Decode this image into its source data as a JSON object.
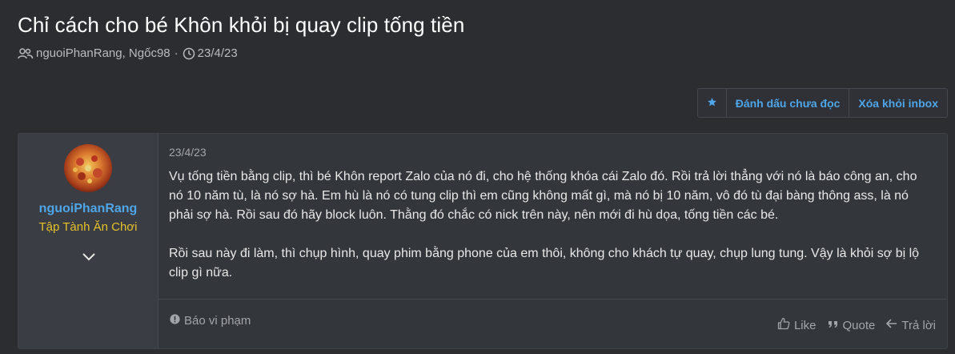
{
  "thread": {
    "title": "Chỉ cách cho bé Khôn khỏi bị quay clip tống tiền",
    "participants": "nguoiPhanRang, Ngốc98",
    "date": "23/4/23"
  },
  "actions": {
    "star_icon": "star-icon",
    "mark_unread": "Đánh dấu chưa đọc",
    "remove_inbox": "Xóa khỏi inbox"
  },
  "post": {
    "author": "nguoiPhanRang",
    "author_title": "Tập Tành Ăn Chơi",
    "date": "23/4/23",
    "paragraphs": [
      "Vụ tống tiền bằng clip, thì bé Khôn report Zalo của nó đi, cho hệ thống khóa cái Zalo đó. Rồi trả lời thẳng với nó là báo công an, cho nó 10 năm tù, là nó sợ hà. Em hù là nó có tung clip thì em cũng không mất gì, mà nó bị 10 năm, vô đó tù đại bàng thông ass, là nó phải sợ hà. Rồi sau đó hãy block luôn. Thằng đó chắc có nick trên này, nên mới đi hù dọa, tống tiền các bé.",
      "Rồi sau này đi làm, thì chụp hình, quay phim bằng phone của em thôi, không cho khách tự quay, chụp lung tung. Vậy là khỏi sợ bị lộ clip gì nữa."
    ],
    "report": "Báo vi phạm",
    "like": "Like",
    "quote": "Quote",
    "reply": "Trả lời"
  },
  "colors": {
    "background": "#2b2d31",
    "accent_link": "#4ea5e8",
    "user_title": "#e6c229"
  }
}
